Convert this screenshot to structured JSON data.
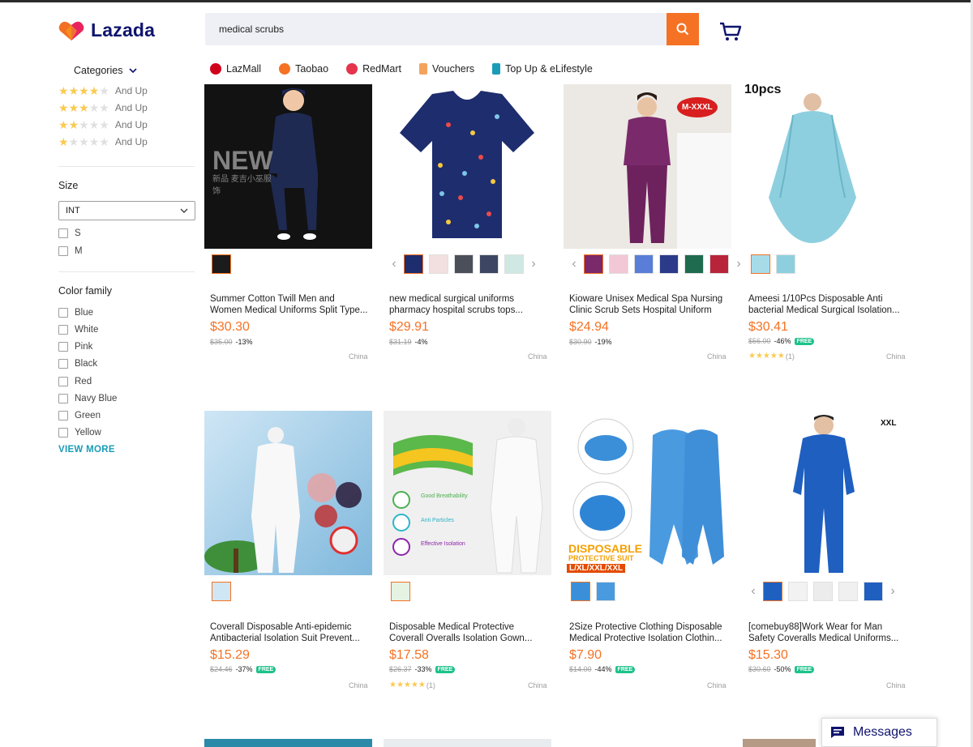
{
  "brand": {
    "name": "Lazada",
    "colors": {
      "accent": "#f57224",
      "primary_text": "#0f146d",
      "link": "#1a9cb7",
      "star": "#faca51",
      "free_badge": "#1ec28b"
    }
  },
  "search": {
    "value": "medical scrubs",
    "button_icon": "search-icon"
  },
  "header": {
    "cart_icon": "cart-icon"
  },
  "nav_links": [
    {
      "label": "LazMall",
      "icon": "lazmall-icon"
    },
    {
      "label": "Taobao",
      "icon": "taobao-icon"
    },
    {
      "label": "RedMart",
      "icon": "redmart-icon"
    },
    {
      "label": "Vouchers",
      "icon": "vouchers-icon"
    },
    {
      "label": "Top Up & eLifestyle",
      "icon": "topup-icon"
    }
  ],
  "sidebar": {
    "categories_label": "Categories",
    "ratings": [
      {
        "stars": 4,
        "label": "And Up"
      },
      {
        "stars": 3,
        "label": "And Up"
      },
      {
        "stars": 2,
        "label": "And Up"
      },
      {
        "stars": 1,
        "label": "And Up"
      }
    ],
    "size": {
      "title": "Size",
      "selected": "INT",
      "options": [
        "S",
        "M"
      ]
    },
    "color_family": {
      "title": "Color family",
      "options": [
        "Blue",
        "White",
        "Pink",
        "Black",
        "Red",
        "Navy Blue",
        "Green",
        "Yellow"
      ],
      "view_more": "VIEW MORE"
    }
  },
  "products": [
    {
      "title": "Summer Cotton Twill Men and Women Medical Uniforms Split Type...",
      "price": "$30.30",
      "original": "$35.00",
      "discount": "-13%",
      "free_shipping": false,
      "country": "China",
      "image_text": "NEW",
      "image_subtext": "新品 麦吉小巫服饰"
    },
    {
      "title": "new medical surgical uniforms pharmacy hospital scrubs tops...",
      "price": "$29.91",
      "original": "$31.19",
      "discount": "-4%",
      "free_shipping": false,
      "country": "China"
    },
    {
      "title": "Kioware Unisex Medical Spa Nursing Clinic Scrub Sets Hospital Uniform",
      "price": "$24.94",
      "original": "$30.90",
      "discount": "-19%",
      "free_shipping": false,
      "country": "China",
      "image_text": "M-XXXL"
    },
    {
      "title": "Ameesi 1/10Pcs Disposable Anti bacterial Medical Surgical Isolation...",
      "price": "$30.41",
      "original": "$56.00",
      "discount": "-46%",
      "free_shipping": true,
      "rating_count": "(1)",
      "country": "China",
      "image_text": "10pcs"
    },
    {
      "title": "Coverall Disposable Anti-epidemic Antibacterial Isolation Suit Prevent...",
      "price": "$15.29",
      "original": "$24.46",
      "discount": "-37%",
      "free_shipping": true,
      "country": "China"
    },
    {
      "title": "Disposable Medical Protective Coverall Overalls Isolation Gown...",
      "price": "$17.58",
      "original": "$26.37",
      "discount": "-33%",
      "free_shipping": true,
      "rating_count": "(1)",
      "country": "China",
      "image_labels": [
        "Good Breathability",
        "Anti Particles",
        "Effective Isolation"
      ]
    },
    {
      "title": "2Size Protective Clothing Disposable Medical Protective Isolation Clothin...",
      "price": "$7.90",
      "original": "$14.00",
      "discount": "-44%",
      "free_shipping": true,
      "country": "China",
      "image_text": "DISPOSABLE",
      "image_subtext": "PROTECTIVE SUIT",
      "image_sizes": "L/XL/XXL/XXL"
    },
    {
      "title": "[comebuy88]Work Wear for Man Safety Coveralls Medical Uniforms...",
      "price": "$15.30",
      "original": "$30.60",
      "discount": "-50%",
      "free_shipping": true,
      "country": "China",
      "image_text": "XXL"
    }
  ],
  "free_label": "FREE",
  "messages": {
    "label": "Messages",
    "icon": "chat-icon"
  }
}
